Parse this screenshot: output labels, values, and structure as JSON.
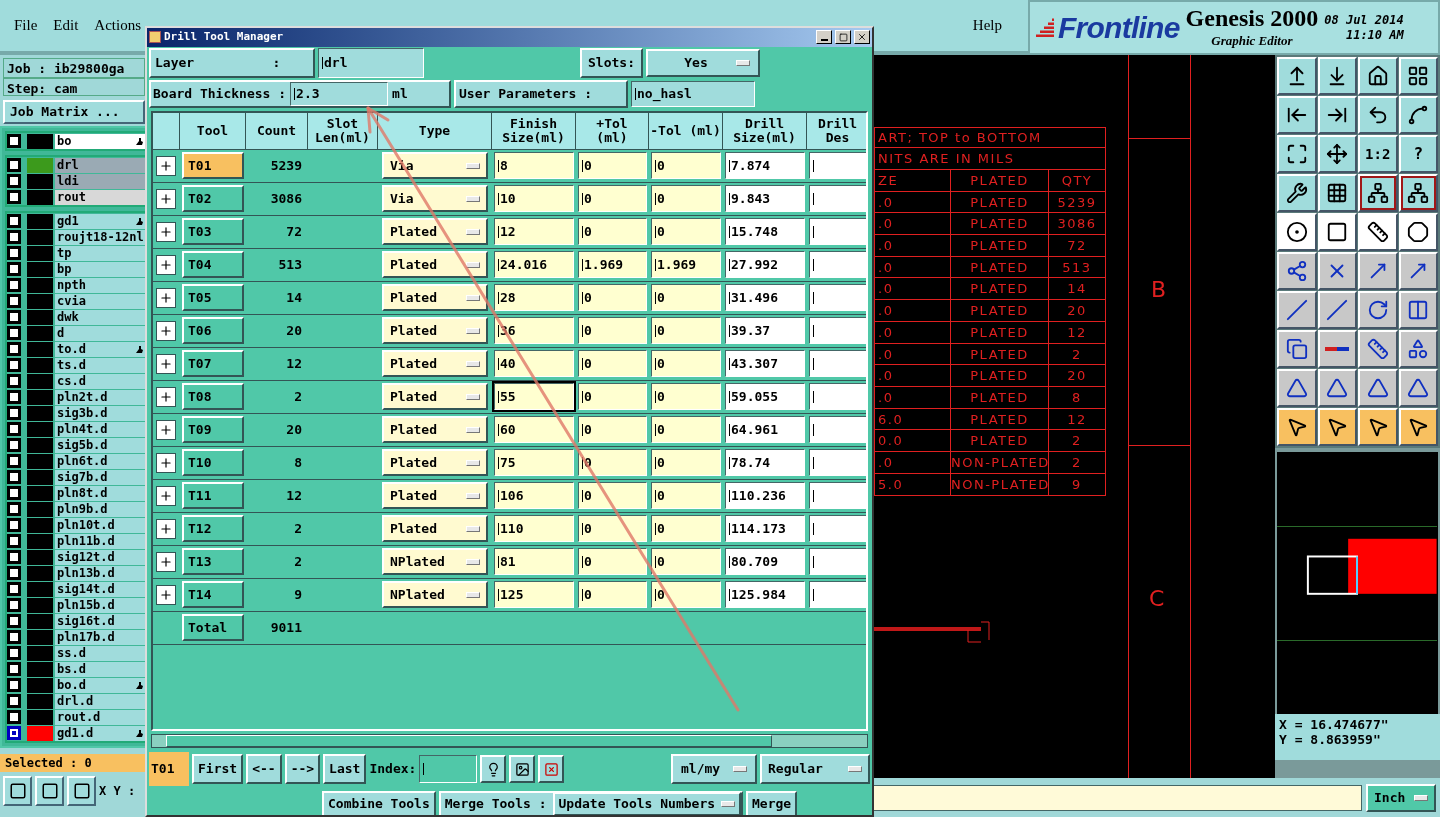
{
  "menu": {
    "items": [
      "File",
      "Edit",
      "Actions"
    ],
    "help": "Help"
  },
  "branding": {
    "logo": "Frontline",
    "product": "Genesis 2000",
    "subtitle": "Graphic Editor",
    "date": "08 Jul 2014",
    "time": "11:10 AM"
  },
  "job_panel": {
    "job": "Job : ib29800ga",
    "step": "Step: cam",
    "matrix_button": "Job Matrix ...",
    "layer_groups": [
      [
        {
          "name": "bo",
          "kind": "board",
          "color": "#000000",
          "affected": true,
          "selected": false
        }
      ],
      [
        {
          "name": "drl",
          "kind": "work",
          "color": "#3c9a1c",
          "affected": false,
          "selected": false
        },
        {
          "name": "ldi",
          "kind": "work",
          "color": "#000000",
          "affected": false,
          "selected": false
        },
        {
          "name": "rout",
          "kind": "context",
          "color": "#000000",
          "affected": false,
          "selected": false
        }
      ],
      [
        {
          "name": "gd1",
          "kind": "normal",
          "color": "#000000",
          "affected": true,
          "selected": false
        },
        {
          "name": "roujt18-12nl",
          "kind": "normal",
          "color": "#000000",
          "affected": false,
          "selected": false
        },
        {
          "name": "tp",
          "kind": "normal",
          "color": "#000000",
          "affected": false,
          "selected": false
        },
        {
          "name": "bp",
          "kind": "normal",
          "color": "#000000",
          "affected": false,
          "selected": false
        },
        {
          "name": "npth",
          "kind": "normal",
          "color": "#000000",
          "affected": false,
          "selected": false
        },
        {
          "name": "cvia",
          "kind": "normal",
          "color": "#000000",
          "affected": false,
          "selected": false
        },
        {
          "name": "dwk",
          "kind": "normal",
          "color": "#000000",
          "affected": false,
          "selected": false
        },
        {
          "name": "d",
          "kind": "normal",
          "color": "#000000",
          "affected": false,
          "selected": false
        },
        {
          "name": "to.d",
          "kind": "normal",
          "color": "#000000",
          "affected": true,
          "selected": false
        },
        {
          "name": "ts.d",
          "kind": "normal",
          "color": "#000000",
          "affected": false,
          "selected": false
        },
        {
          "name": "cs.d",
          "kind": "normal",
          "color": "#000000",
          "affected": false,
          "selected": false
        },
        {
          "name": "pln2t.d",
          "kind": "normal",
          "color": "#000000",
          "affected": false,
          "selected": false
        },
        {
          "name": "sig3b.d",
          "kind": "normal",
          "color": "#000000",
          "affected": false,
          "selected": false
        },
        {
          "name": "pln4t.d",
          "kind": "normal",
          "color": "#000000",
          "affected": false,
          "selected": false
        },
        {
          "name": "sig5b.d",
          "kind": "normal",
          "color": "#000000",
          "affected": false,
          "selected": false
        },
        {
          "name": "pln6t.d",
          "kind": "normal",
          "color": "#000000",
          "affected": false,
          "selected": false
        },
        {
          "name": "sig7b.d",
          "kind": "normal",
          "color": "#000000",
          "affected": false,
          "selected": false
        },
        {
          "name": "pln8t.d",
          "kind": "normal",
          "color": "#000000",
          "affected": false,
          "selected": false
        },
        {
          "name": "pln9b.d",
          "kind": "normal",
          "color": "#000000",
          "affected": false,
          "selected": false
        },
        {
          "name": "pln10t.d",
          "kind": "normal",
          "color": "#000000",
          "affected": false,
          "selected": false
        },
        {
          "name": "pln11b.d",
          "kind": "normal",
          "color": "#000000",
          "affected": false,
          "selected": false
        },
        {
          "name": "sig12t.d",
          "kind": "normal",
          "color": "#000000",
          "affected": false,
          "selected": false
        },
        {
          "name": "pln13b.d",
          "kind": "normal",
          "color": "#000000",
          "affected": false,
          "selected": false
        },
        {
          "name": "sig14t.d",
          "kind": "normal",
          "color": "#000000",
          "affected": false,
          "selected": false
        },
        {
          "name": "pln15b.d",
          "kind": "normal",
          "color": "#000000",
          "affected": false,
          "selected": false
        },
        {
          "name": "sig16t.d",
          "kind": "normal",
          "color": "#000000",
          "affected": false,
          "selected": false
        },
        {
          "name": "pln17b.d",
          "kind": "normal",
          "color": "#000000",
          "affected": false,
          "selected": false
        },
        {
          "name": "ss.d",
          "kind": "normal",
          "color": "#000000",
          "affected": false,
          "selected": false
        },
        {
          "name": "bs.d",
          "kind": "normal",
          "color": "#000000",
          "affected": false,
          "selected": false
        },
        {
          "name": "bo.d",
          "kind": "normal",
          "color": "#000000",
          "affected": true,
          "selected": false
        },
        {
          "name": "drl.d",
          "kind": "normal",
          "color": "#000000",
          "affected": false,
          "selected": false
        },
        {
          "name": "rout.d",
          "kind": "normal",
          "color": "#000000",
          "affected": false,
          "selected": false
        },
        {
          "name": "gd1.d",
          "kind": "normal",
          "color": "#ff0000",
          "affected": true,
          "selected": true
        }
      ]
    ],
    "selected_count": "Selected : 0",
    "xy_label": "X Y :"
  },
  "canvas": {
    "table_title": "ART; TOP to BOTTOM",
    "table_note": "NITS ARE IN MILS",
    "columns": [
      "ZE",
      "PLATED",
      "QTY"
    ],
    "rows": [
      [
        ".0",
        "PLATED",
        "5239"
      ],
      [
        ".0",
        "PLATED",
        "3086"
      ],
      [
        ".0",
        "PLATED",
        "72"
      ],
      [
        ".0",
        "PLATED",
        "513"
      ],
      [
        ".0",
        "PLATED",
        "14"
      ],
      [
        ".0",
        "PLATED",
        "20"
      ],
      [
        ".0",
        "PLATED",
        "12"
      ],
      [
        ".0",
        "PLATED",
        "2"
      ],
      [
        ".0",
        "PLATED",
        "20"
      ],
      [
        ".0",
        "PLATED",
        "8"
      ],
      [
        "6.0",
        "PLATED",
        "12"
      ],
      [
        "0.0",
        "PLATED",
        "2"
      ],
      [
        ".0",
        "NON-PLATED",
        "2"
      ],
      [
        "5.0",
        "NON-PLATED",
        "9"
      ]
    ],
    "zone_labels": [
      "B",
      "C"
    ]
  },
  "right_toolbar": {
    "ratio_button": "1:2",
    "help_button": "?",
    "x": "X = 16.474677\"",
    "y": "Y = 8.863959\"",
    "units": "Inch"
  },
  "dialog": {
    "title": "Drill Tool Manager",
    "layer_label": "Layer          :",
    "layer": "drl",
    "slots_label": "Slots:",
    "slots": "Yes",
    "thickness_label": "Board Thickness :",
    "thickness": "2.3",
    "thickness_unit": "ml",
    "user_params_label": "User Parameters :",
    "user_params": "no_hasl",
    "columns": [
      "Tool",
      "Count",
      "Slot Len(ml)",
      "Type",
      "Finish Size(ml)",
      "+Tol (ml)",
      "-Tol (ml)",
      "Drill Size(ml)",
      "Drill Des"
    ],
    "rows": [
      {
        "tool": "T01",
        "count": "5239",
        "type": "Via",
        "finish": "8",
        "plus": "0",
        "minus": "0",
        "drill": "7.874",
        "selected": true,
        "focused": false
      },
      {
        "tool": "T02",
        "count": "3086",
        "type": "Via",
        "finish": "10",
        "plus": "0",
        "minus": "0",
        "drill": "9.843",
        "selected": false,
        "focused": false
      },
      {
        "tool": "T03",
        "count": "72",
        "type": "Plated",
        "finish": "12",
        "plus": "0",
        "minus": "0",
        "drill": "15.748",
        "selected": false,
        "focused": false
      },
      {
        "tool": "T04",
        "count": "513",
        "type": "Plated",
        "finish": "24.016",
        "plus": "1.969",
        "minus": "1.969",
        "drill": "27.992",
        "selected": false,
        "focused": false
      },
      {
        "tool": "T05",
        "count": "14",
        "type": "Plated",
        "finish": "28",
        "plus": "0",
        "minus": "0",
        "drill": "31.496",
        "selected": false,
        "focused": false
      },
      {
        "tool": "T06",
        "count": "20",
        "type": "Plated",
        "finish": "36",
        "plus": "0",
        "minus": "0",
        "drill": "39.37",
        "selected": false,
        "focused": false
      },
      {
        "tool": "T07",
        "count": "12",
        "type": "Plated",
        "finish": "40",
        "plus": "0",
        "minus": "0",
        "drill": "43.307",
        "selected": false,
        "focused": false
      },
      {
        "tool": "T08",
        "count": "2",
        "type": "Plated",
        "finish": "55",
        "plus": "0",
        "minus": "0",
        "drill": "59.055",
        "selected": false,
        "focused": true
      },
      {
        "tool": "T09",
        "count": "20",
        "type": "Plated",
        "finish": "60",
        "plus": "0",
        "minus": "0",
        "drill": "64.961",
        "selected": false,
        "focused": false
      },
      {
        "tool": "T10",
        "count": "8",
        "type": "Plated",
        "finish": "75",
        "plus": "0",
        "minus": "0",
        "drill": "78.74",
        "selected": false,
        "focused": false
      },
      {
        "tool": "T11",
        "count": "12",
        "type": "Plated",
        "finish": "106",
        "plus": "0",
        "minus": "0",
        "drill": "110.236",
        "selected": false,
        "focused": false
      },
      {
        "tool": "T12",
        "count": "2",
        "type": "Plated",
        "finish": "110",
        "plus": "0",
        "minus": "0",
        "drill": "114.173",
        "selected": false,
        "focused": false
      },
      {
        "tool": "T13",
        "count": "2",
        "type": "NPlated",
        "finish": "81",
        "plus": "0",
        "minus": "0",
        "drill": "80.709",
        "selected": false,
        "focused": false
      },
      {
        "tool": "T14",
        "count": "9",
        "type": "NPlated",
        "finish": "125",
        "plus": "0",
        "minus": "0",
        "drill": "125.984",
        "selected": false,
        "focused": false
      }
    ],
    "total_label": "Total",
    "total": "9011",
    "current_tool": "T01",
    "nav": [
      "First",
      "<--",
      "-->",
      "Last"
    ],
    "index_label": "Index:",
    "units": "ml/my",
    "mode": "Regular",
    "footer": {
      "combine": "Combine Tools",
      "merge_label": "Merge Tools :",
      "update": "Update Tools Numbers",
      "merge": "Merge"
    }
  }
}
